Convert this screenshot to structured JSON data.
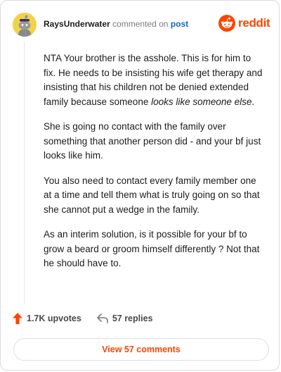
{
  "header": {
    "username": "RaysUnderwater",
    "action": "commented on",
    "post_link": "post",
    "brand": "reddit"
  },
  "comment": {
    "paragraphs": [
      {
        "before": "NTA Your brother is the asshole. This is for him to fix. He needs to be insisting his wife get therapy and insisting that his children not be denied extended family because someone ",
        "italic": "looks like someone else",
        "after": "."
      },
      {
        "before": "She is going no contact with the family over something that another person did - and your bf just looks like him.",
        "italic": "",
        "after": ""
      },
      {
        "before": "You also need to contact every family member one at a time and tell them what is truly going on so that she cannot put a wedge in the family.",
        "italic": "",
        "after": ""
      },
      {
        "before": "As an interim solution, is it possible for your bf to grow a beard or groom himself differently ? Not that he should have to.",
        "italic": "",
        "after": ""
      }
    ]
  },
  "footer": {
    "upvotes": "1.7K upvotes",
    "replies": "57 replies"
  },
  "view_button": "View 57 comments",
  "icons": {
    "avatar": "snoo-avatar-icon",
    "brand": "reddit-logo-icon",
    "upvote": "upvote-arrow-icon",
    "reply": "reply-arrow-icon"
  },
  "colors": {
    "brand": "#ff4500",
    "link": "#1565c0",
    "avatar_bg": "#f3d24a"
  }
}
